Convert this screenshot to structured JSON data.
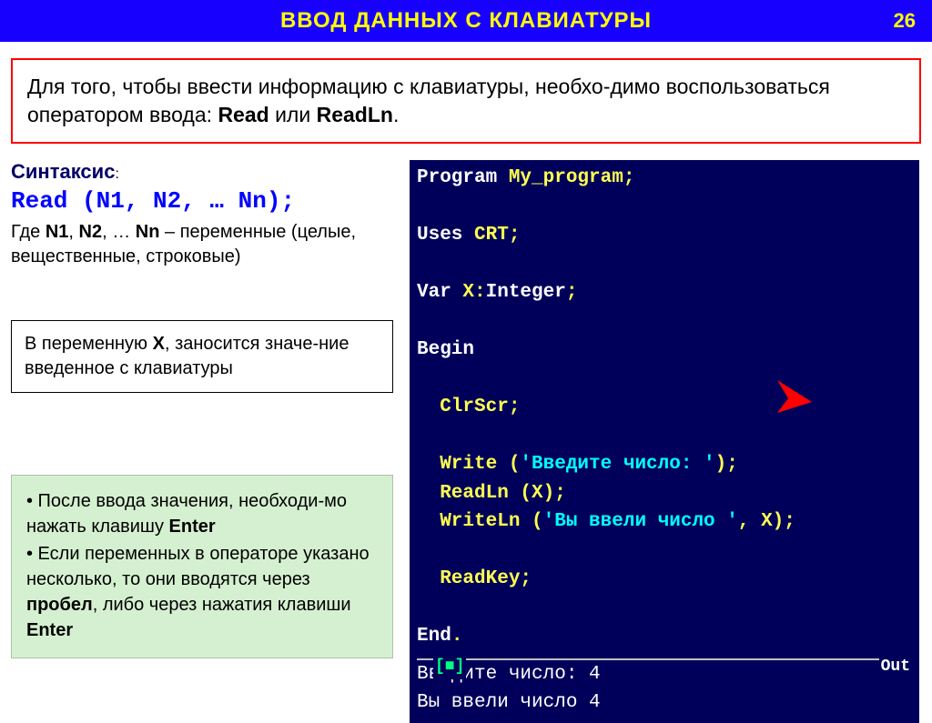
{
  "header": {
    "title": "ВВОД ДАННЫХ С КЛАВИАТУРЫ",
    "slide_number": "26"
  },
  "intro": {
    "text_before": "Для того, чтобы ввести информацию с клавиатуры, необхо-димо воспользоваться оператором ввода: ",
    "kw1": "Read",
    "or": " или ",
    "kw2": "ReadLn",
    "period": "."
  },
  "syntax": {
    "label": "Синтаксис",
    "colon": ":",
    "code": "Read (N1, N2, … Nn);",
    "desc_prefix": "Где ",
    "n1": "N1",
    "c1": ", ",
    "n2": "N2",
    "c2": ", … ",
    "nn": "Nn",
    "desc_suffix": " – переменные (целые, вещественные, строковые)"
  },
  "varbox": {
    "t1": "В переменную ",
    "x": "X",
    "t2": ", заносится значе-ние введенное с клавиатуры"
  },
  "greenbox": {
    "b1a": "• После ввода значения, необходи-мо нажать клавишу ",
    "b1b": "Enter",
    "b2a": "• Если переменных в операторе указано несколько, то они вводятся через ",
    "b2b": "пробел",
    "b2c": ", либо через нажатия клавиши ",
    "b2d": "Enter"
  },
  "code": {
    "l1_a": "Program",
    "l1_b": " My_program;",
    "l2_a": "Uses",
    "l2_b": " CRT;",
    "l3_a": "Var",
    "l3_b": " X:",
    "l3_c": "Integer",
    "l3_d": ";",
    "l4": "Begin",
    "l5": "  ClrScr;",
    "l6_a": "  Write (",
    "l6_b": "'Введите число: '",
    "l6_c": ");",
    "l7": "  ReadLn (X);",
    "l8_a": "  WriteLn (",
    "l8_b": "'Вы ввели число '",
    "l8_c": ", X);",
    "l9": "  ReadKey;",
    "l10": "End",
    "l10_dot": ".",
    "out_label": "Out",
    "out1": "Введите число: 4",
    "out2": "Вы ввели число 4"
  }
}
